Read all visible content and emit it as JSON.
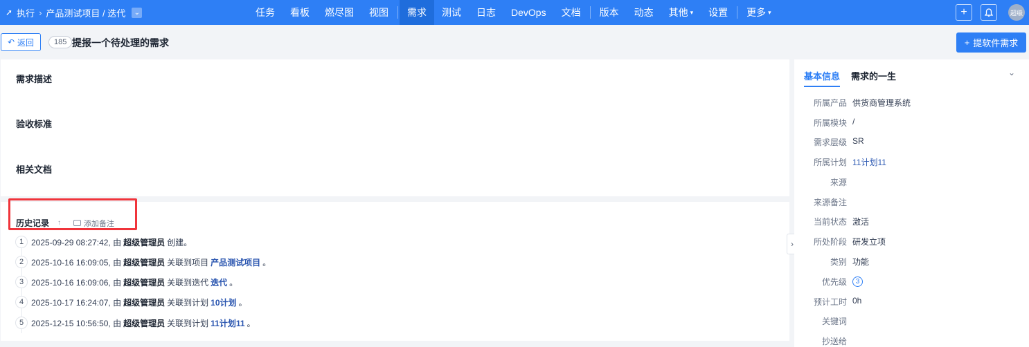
{
  "breadcrumb": {
    "root": "执行",
    "project": "产品测试项目 / 迭代"
  },
  "nav": {
    "items": [
      "任务",
      "看板",
      "燃尽图",
      "视图",
      "需求",
      "测试",
      "日志",
      "DevOps",
      "文档",
      "版本",
      "动态",
      "其他",
      "设置",
      "更多"
    ],
    "active": "需求"
  },
  "user": {
    "avatar_text": "超级"
  },
  "header": {
    "back_label": "返回",
    "id": "185",
    "title": "提报一个待处理的需求",
    "add_button": "提软件需求"
  },
  "sections": {
    "description": "需求描述",
    "acceptance": "验收标准",
    "docs": "相关文档"
  },
  "history": {
    "title": "历史记录",
    "add_note": "添加备注",
    "entries": [
      {
        "num": "1",
        "time": "2025-09-29 08:27:42, 由",
        "actor": "超级管理员",
        "action": "创建。",
        "target": "",
        "end": ""
      },
      {
        "num": "2",
        "time": "2025-10-16 16:09:05, 由",
        "actor": "超级管理员",
        "action": "关联到项目",
        "target": "产品测试项目",
        "end": "。"
      },
      {
        "num": "3",
        "time": "2025-10-16 16:09:06, 由",
        "actor": "超级管理员",
        "action": "关联到迭代",
        "target": "迭代",
        "end": "。"
      },
      {
        "num": "4",
        "time": "2025-10-17 16:24:07, 由",
        "actor": "超级管理员",
        "action": "关联到计划",
        "target": "10计划",
        "end": "。"
      },
      {
        "num": "5",
        "time": "2025-12-15 10:56:50, 由",
        "actor": "超级管理员",
        "action": "关联到计划",
        "target": "11计划11",
        "end": "。"
      }
    ]
  },
  "side": {
    "tabs": [
      "基本信息",
      "需求的一生"
    ],
    "fields": [
      {
        "label": "所属产品",
        "value": "供货商管理系统"
      },
      {
        "label": "所属模块",
        "value": "/"
      },
      {
        "label": "需求层级",
        "value": "SR"
      },
      {
        "label": "所属计划",
        "value": "11计划11"
      },
      {
        "label": "来源",
        "value": ""
      },
      {
        "label": "来源备注",
        "value": ""
      },
      {
        "label": "当前状态",
        "value": "激活"
      },
      {
        "label": "所处阶段",
        "value": "研发立项"
      },
      {
        "label": "类别",
        "value": "功能"
      },
      {
        "label": "优先级",
        "value": "3"
      },
      {
        "label": "预计工时",
        "value": "0h"
      },
      {
        "label": "关键词",
        "value": ""
      },
      {
        "label": "抄送给",
        "value": ""
      }
    ]
  },
  "colors": {
    "brand": "#2e7ff5",
    "highlight": "#f0343b"
  }
}
